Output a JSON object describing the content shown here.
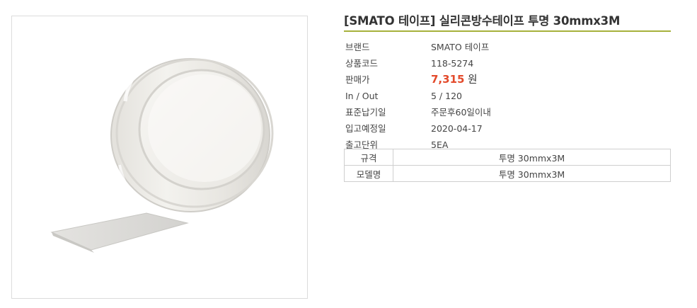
{
  "product": {
    "title": "[SMATO 테이프] 실리콘방수테이프 투명 30mmx3M",
    "image_alt": "transparent silicone tape roll"
  },
  "specs": [
    {
      "label": "브랜드",
      "value": "SMATO 테이프"
    },
    {
      "label": "상품코드",
      "value": "118-5274"
    },
    {
      "label": "판매가",
      "price": "7,315",
      "currency": "원"
    },
    {
      "label": "In / Out",
      "value": "5 / 120"
    },
    {
      "label": "표준납기일",
      "value": "주문후60일이내"
    },
    {
      "label": "입고예정일",
      "value": "2020-04-17"
    },
    {
      "label": "출고단위",
      "value": "5EA"
    }
  ],
  "options": [
    {
      "key": "규격",
      "value": "투명 30mmx3M"
    },
    {
      "key": "모델명",
      "value": "투명 30mmx3M"
    }
  ],
  "colors": {
    "accent_rule": "#a6b13c",
    "price": "#e34a2b"
  }
}
